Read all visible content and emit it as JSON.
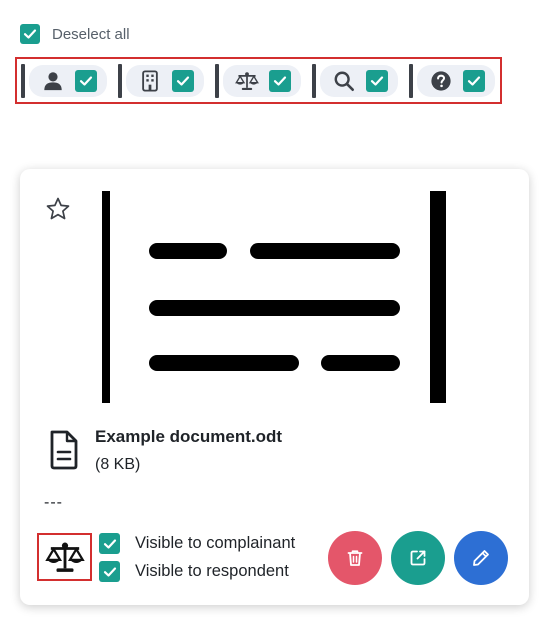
{
  "deselect": {
    "label": "Deselect all",
    "checked": true
  },
  "filters": [
    {
      "icon": "person-icon",
      "checked": true
    },
    {
      "icon": "building-icon",
      "checked": true
    },
    {
      "icon": "scale-icon",
      "checked": true
    },
    {
      "icon": "search-icon",
      "checked": true
    },
    {
      "icon": "question-icon",
      "checked": true
    }
  ],
  "card": {
    "file_name": "Example document.odt",
    "file_size": "(8 KB)",
    "description": "---",
    "visibility": {
      "complainant_label": "Visible to complainant",
      "complainant_checked": true,
      "respondent_label": "Visible to respondent",
      "respondent_checked": true
    }
  },
  "colors": {
    "accent": "#1a9e8f",
    "delete": "#e4566a",
    "edit": "#2d6fd4",
    "highlight_border": "#d32f2f"
  }
}
